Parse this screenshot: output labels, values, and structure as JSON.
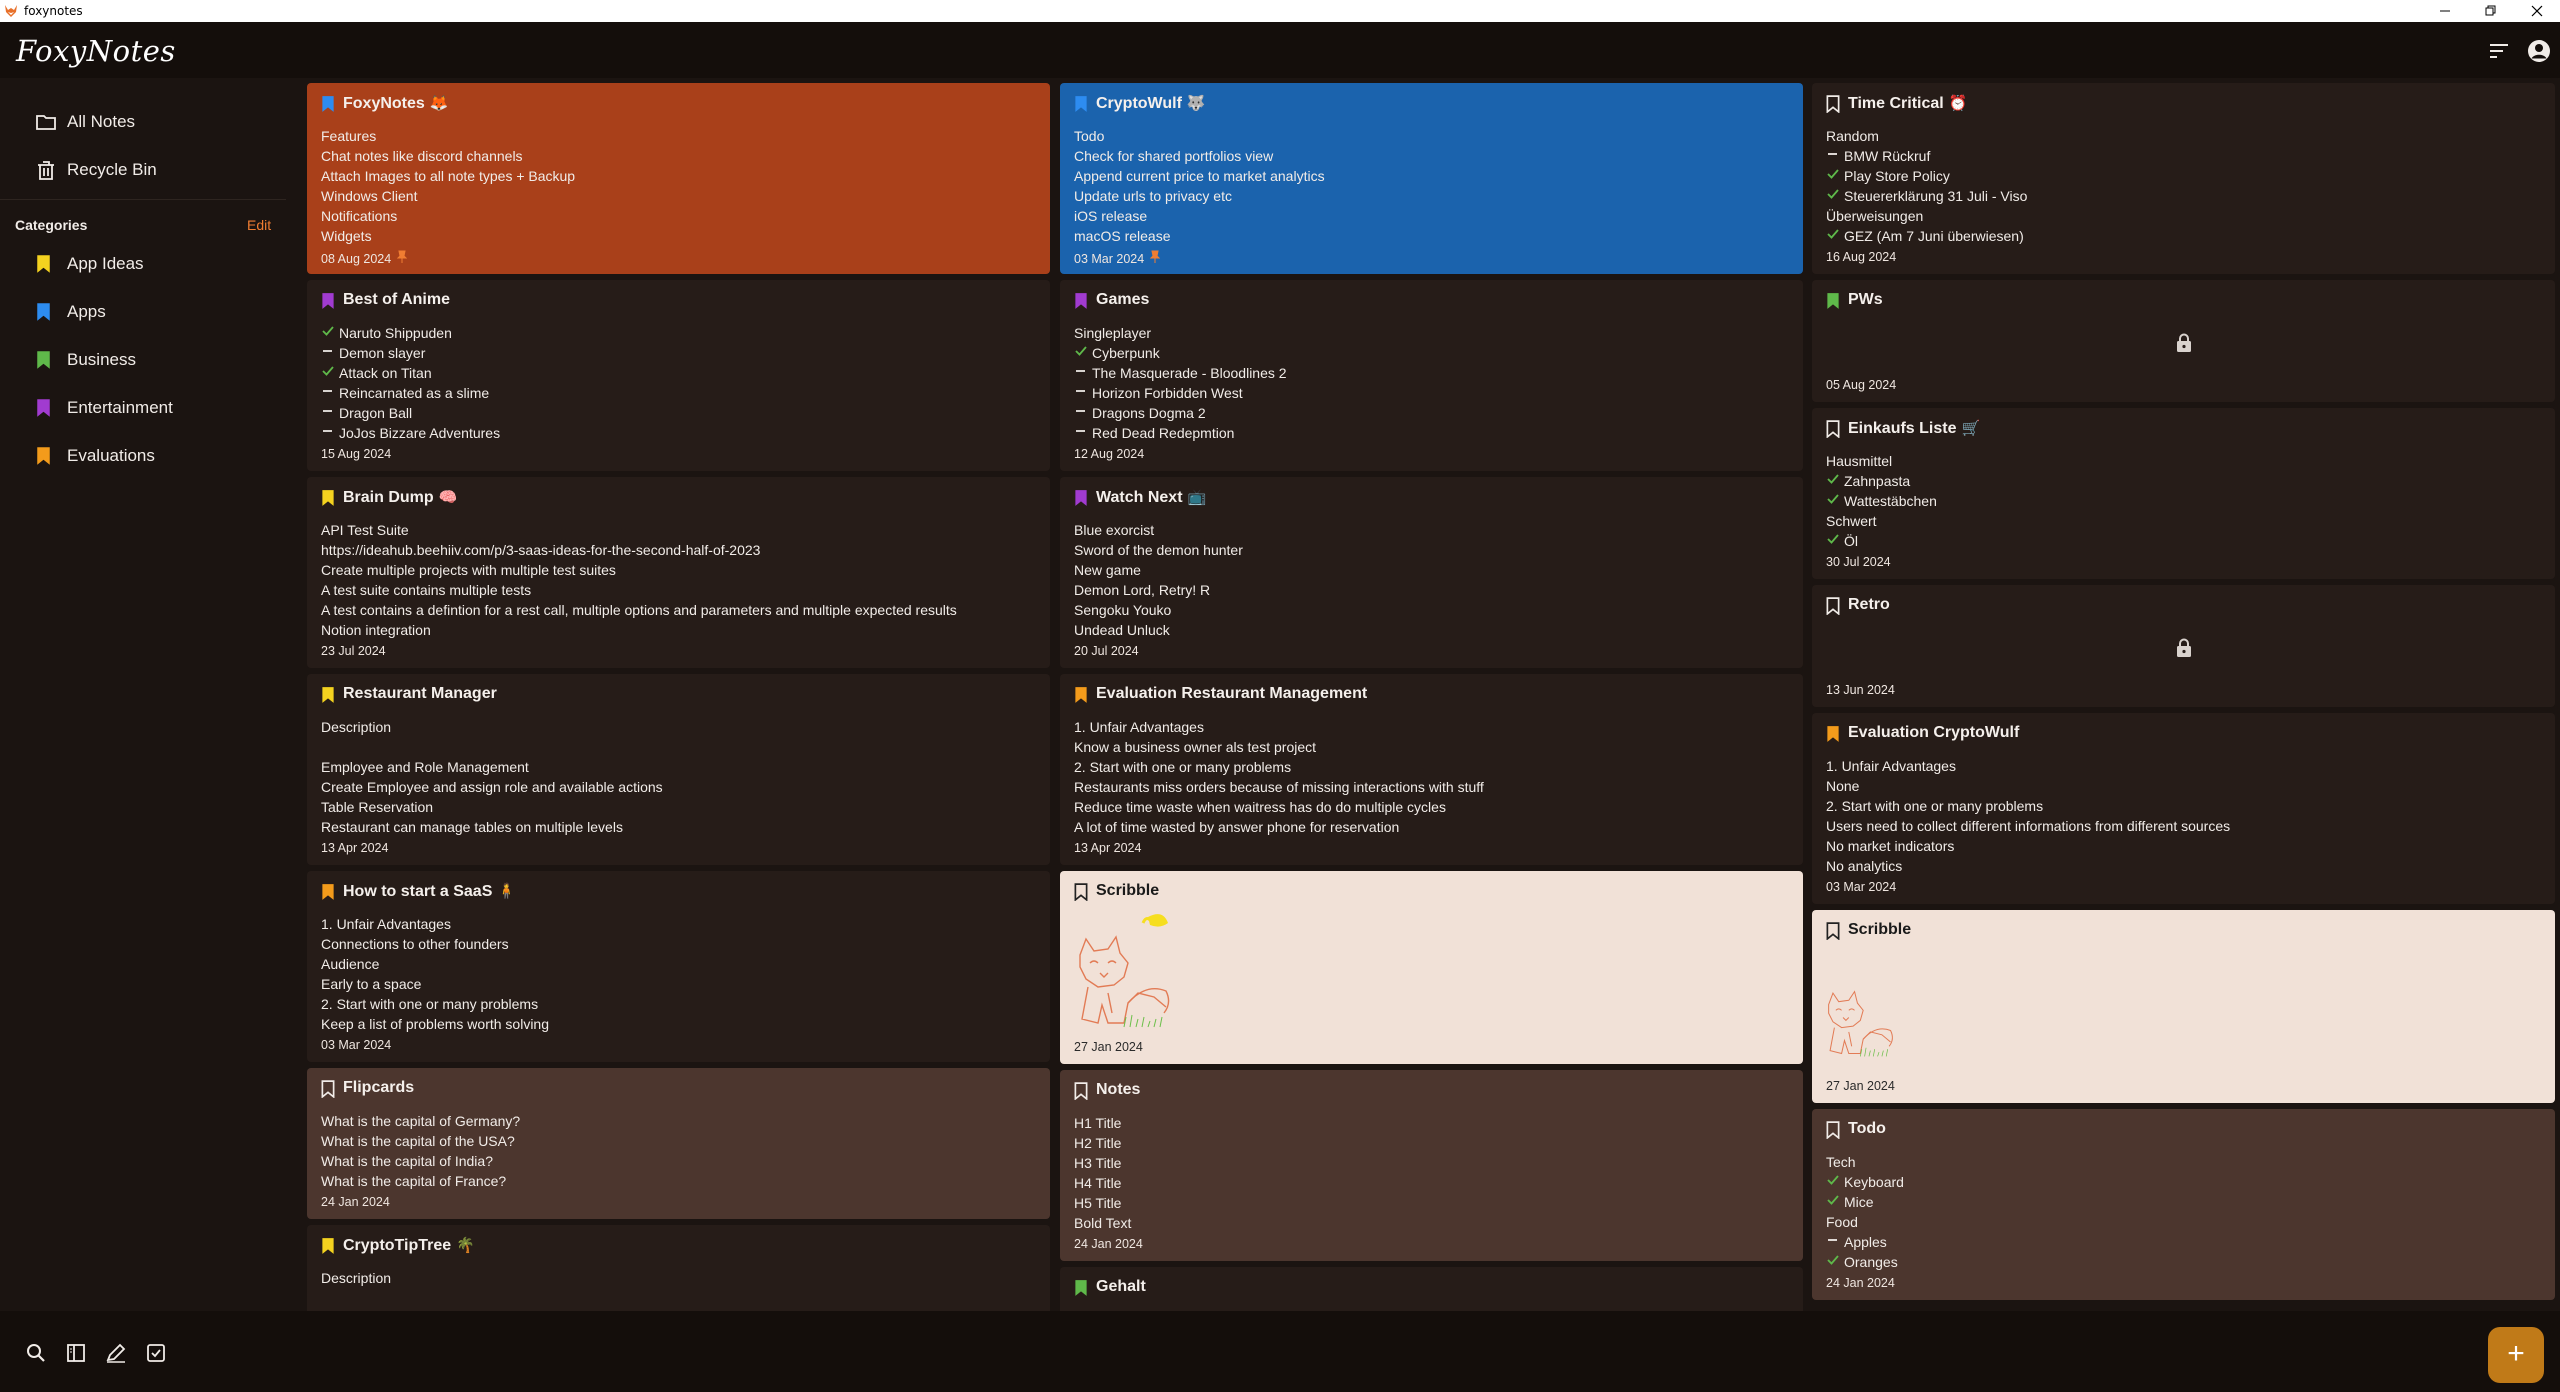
{
  "window": {
    "title": "foxynotes"
  },
  "app": {
    "logo": "FoxyNotes"
  },
  "sidebar": {
    "nav": [
      {
        "label": "All Notes",
        "icon": "folder-icon"
      },
      {
        "label": "Recycle Bin",
        "icon": "trash-icon"
      }
    ],
    "categories_heading": "Categories",
    "edit_label": "Edit",
    "categories": [
      {
        "label": "App Ideas",
        "color": "#f4d21f"
      },
      {
        "label": "Apps",
        "color": "#2d8cf0"
      },
      {
        "label": "Business",
        "color": "#5fb94a"
      },
      {
        "label": "Entertainment",
        "color": "#a13bd0"
      },
      {
        "label": "Evaluations",
        "color": "#f39b1b"
      }
    ]
  },
  "columns": [
    [
      {
        "title": "FoxyNotes",
        "emoji": "🦊",
        "bookmark": "#2d8cf0",
        "style": "orange",
        "pinned": true,
        "lines": [
          {
            "t": "Features"
          },
          {
            "t": "Chat notes like discord channels"
          },
          {
            "t": "Attach Images to all note types + Backup"
          },
          {
            "t": "Windows Client"
          },
          {
            "t": "Notifications"
          },
          {
            "t": "Widgets"
          }
        ],
        "date": "08 Aug 2024"
      },
      {
        "title": "Best of Anime",
        "emoji": "",
        "bookmark": "#a13bd0",
        "style": "",
        "lines": [
          {
            "t": "Naruto Shippuden",
            "m": "check"
          },
          {
            "t": "Demon slayer",
            "m": "dash"
          },
          {
            "t": "Attack on Titan",
            "m": "check"
          },
          {
            "t": "Reincarnated as a slime",
            "m": "dash"
          },
          {
            "t": "Dragon Ball",
            "m": "dash"
          },
          {
            "t": "JoJos Bizzare Adventures",
            "m": "dash"
          }
        ],
        "date": "15 Aug 2024"
      },
      {
        "title": "Brain Dump",
        "emoji": "🧠",
        "bookmark": "#f4d21f",
        "style": "",
        "lines": [
          {
            "t": "API Test Suite"
          },
          {
            "t": "https://ideahub.beehiiv.com/p/3-saas-ideas-for-the-second-half-of-2023"
          },
          {
            "t": "Create multiple projects with multiple test suites"
          },
          {
            "t": "A test suite contains multiple tests"
          },
          {
            "t": "A test contains a defintion for a rest call, multiple options and parameters and multiple expected results"
          },
          {
            "t": "Notion integration"
          }
        ],
        "date": "23 Jul 2024"
      },
      {
        "title": "Restaurant Manager",
        "emoji": "",
        "bookmark": "#f4d21f",
        "style": "",
        "lines": [
          {
            "t": "Description"
          },
          {
            "t": ""
          },
          {
            "t": "Employee and Role Management"
          },
          {
            "t": "Create Employee and assign role and available actions"
          },
          {
            "t": "Table Reservation"
          },
          {
            "t": "Restaurant can manage tables on multiple levels"
          }
        ],
        "date": "13 Apr 2024"
      },
      {
        "title": "How to start a SaaS",
        "emoji": "🧍",
        "bookmark": "#f39b1b",
        "style": "",
        "lines": [
          {
            "t": "1. Unfair Advantages"
          },
          {
            "t": "Connections to other founders"
          },
          {
            "t": "Audience"
          },
          {
            "t": "Early to a space"
          },
          {
            "t": "2. Start with one or many problems"
          },
          {
            "t": "Keep a list of problems worth solving"
          }
        ],
        "date": "03 Mar 2024"
      },
      {
        "title": "Flipcards",
        "emoji": "",
        "bookmark": "outline",
        "style": "brown",
        "lines": [
          {
            "t": "What is the capital of Germany?"
          },
          {
            "t": "What is the capital of the USA?"
          },
          {
            "t": "What is the capital of India?"
          },
          {
            "t": "What is the capital of France?"
          }
        ],
        "date": "24 Jan 2024"
      },
      {
        "title": "CryptoTipTree",
        "emoji": "🌴",
        "bookmark": "#f4d21f",
        "style": "",
        "lines": [
          {
            "t": "Description"
          }
        ],
        "date": ""
      }
    ],
    [
      {
        "title": "CryptoWulf",
        "emoji": "🐺",
        "bookmark": "#2d8cf0",
        "style": "blue",
        "pinned": true,
        "lines": [
          {
            "t": "Todo"
          },
          {
            "t": "Check for shared portfolios view"
          },
          {
            "t": "Append current price to market analytics"
          },
          {
            "t": "Update urls to privacy etc"
          },
          {
            "t": "iOS release"
          },
          {
            "t": "macOS release"
          }
        ],
        "date": "03 Mar 2024"
      },
      {
        "title": "Games",
        "emoji": "",
        "bookmark": "#a13bd0",
        "style": "",
        "lines": [
          {
            "t": "Singleplayer"
          },
          {
            "t": "Cyberpunk",
            "m": "check"
          },
          {
            "t": "The Masquerade - Bloodlines 2",
            "m": "dash"
          },
          {
            "t": "Horizon Forbidden West",
            "m": "dash"
          },
          {
            "t": "Dragons Dogma 2",
            "m": "dash"
          },
          {
            "t": "Red Dead Redepmtion",
            "m": "dash"
          }
        ],
        "date": "12 Aug 2024"
      },
      {
        "title": "Watch Next",
        "emoji": "📺",
        "bookmark": "#a13bd0",
        "style": "",
        "lines": [
          {
            "t": "Blue exorcist"
          },
          {
            "t": "Sword of the demon hunter"
          },
          {
            "t": "New game"
          },
          {
            "t": "Demon Lord, Retry! R"
          },
          {
            "t": "Sengoku Youko"
          },
          {
            "t": "Undead Unluck"
          }
        ],
        "date": "20 Jul 2024"
      },
      {
        "title": "Evaluation Restaurant Management",
        "emoji": "",
        "bookmark": "#f39b1b",
        "style": "",
        "lines": [
          {
            "t": "1. Unfair Advantages"
          },
          {
            "t": "Know a business owner als test project"
          },
          {
            "t": "2. Start with one or many problems"
          },
          {
            "t": "Restaurants miss orders because of missing interactions with stuff"
          },
          {
            "t": "Reduce time waste when waitress has do do multiple cycles"
          },
          {
            "t": "A lot of time wasted by answer phone for reservation"
          }
        ],
        "date": "13 Apr 2024"
      },
      {
        "title": "Scribble",
        "emoji": "",
        "bookmark": "outline-dark",
        "style": "paper",
        "scribble": true,
        "lines": [],
        "date": "27 Jan 2024"
      },
      {
        "title": "Notes",
        "emoji": "",
        "bookmark": "outline",
        "style": "brown",
        "lines": [
          {
            "t": "H1 Title"
          },
          {
            "t": "H2 Title"
          },
          {
            "t": "H3 Title"
          },
          {
            "t": "H4 Title"
          },
          {
            "t": "H5 Title"
          },
          {
            "t": "Bold Text"
          }
        ],
        "date": "24 Jan 2024"
      },
      {
        "title": "Gehalt",
        "emoji": "",
        "bookmark": "#5fb94a",
        "style": "",
        "lines": [],
        "date": ""
      }
    ],
    [
      {
        "title": "Time Critical",
        "emoji": "⏰",
        "bookmark": "outline",
        "style": "",
        "lines": [
          {
            "t": "Random"
          },
          {
            "t": "BMW Rückruf",
            "m": "dash"
          },
          {
            "t": "Play Store Policy",
            "m": "check"
          },
          {
            "t": "Steuererklärung 31 Juli - Viso",
            "m": "check"
          },
          {
            "t": "Überweisungen"
          },
          {
            "t": "GEZ (Am 7 Juni überwiesen)",
            "m": "check"
          }
        ],
        "date": "16 Aug 2024"
      },
      {
        "title": "PWs",
        "emoji": "",
        "bookmark": "#5fb94a",
        "style": "",
        "locked": true,
        "lines": [],
        "date": "05 Aug 2024"
      },
      {
        "title": "Einkaufs Liste",
        "emoji": "🛒",
        "bookmark": "outline",
        "style": "",
        "lines": [
          {
            "t": "Hausmittel"
          },
          {
            "t": "Zahnpasta",
            "m": "check"
          },
          {
            "t": "Wattestäbchen",
            "m": "check"
          },
          {
            "t": "Schwert"
          },
          {
            "t": "Öl",
            "m": "check"
          }
        ],
        "date": "30 Jul 2024"
      },
      {
        "title": "Retro",
        "emoji": "",
        "bookmark": "outline",
        "style": "",
        "locked": true,
        "lines": [],
        "date": "13 Jun 2024"
      },
      {
        "title": "Evaluation CryptoWulf",
        "emoji": "",
        "bookmark": "#f39b1b",
        "style": "",
        "lines": [
          {
            "t": "1. Unfair Advantages"
          },
          {
            "t": "None"
          },
          {
            "t": "2. Start with one or many problems"
          },
          {
            "t": "Users need to collect different informations from different sources"
          },
          {
            "t": "No market indicators"
          },
          {
            "t": "No analytics"
          }
        ],
        "date": "03 Mar 2024"
      },
      {
        "title": "Scribble",
        "emoji": "",
        "bookmark": "outline-dark",
        "style": "paper",
        "scribble": true,
        "small": true,
        "lines": [],
        "date": "27 Jan 2024"
      },
      {
        "title": "Todo",
        "emoji": "",
        "bookmark": "outline",
        "style": "brown",
        "lines": [
          {
            "t": "Tech"
          },
          {
            "t": "Keyboard",
            "m": "check"
          },
          {
            "t": "Mice",
            "m": "check"
          },
          {
            "t": "Food"
          },
          {
            "t": "Apples",
            "m": "dash"
          },
          {
            "t": "Oranges",
            "m": "check"
          }
        ],
        "date": "24 Jan 2024"
      }
    ]
  ],
  "bottombar": {
    "icons": [
      "search-icon",
      "split-view-icon",
      "edit-icon",
      "checklist-icon"
    ],
    "fab": "+"
  },
  "colors": {
    "accent": "#f07d32",
    "check": "#5fb94a"
  }
}
